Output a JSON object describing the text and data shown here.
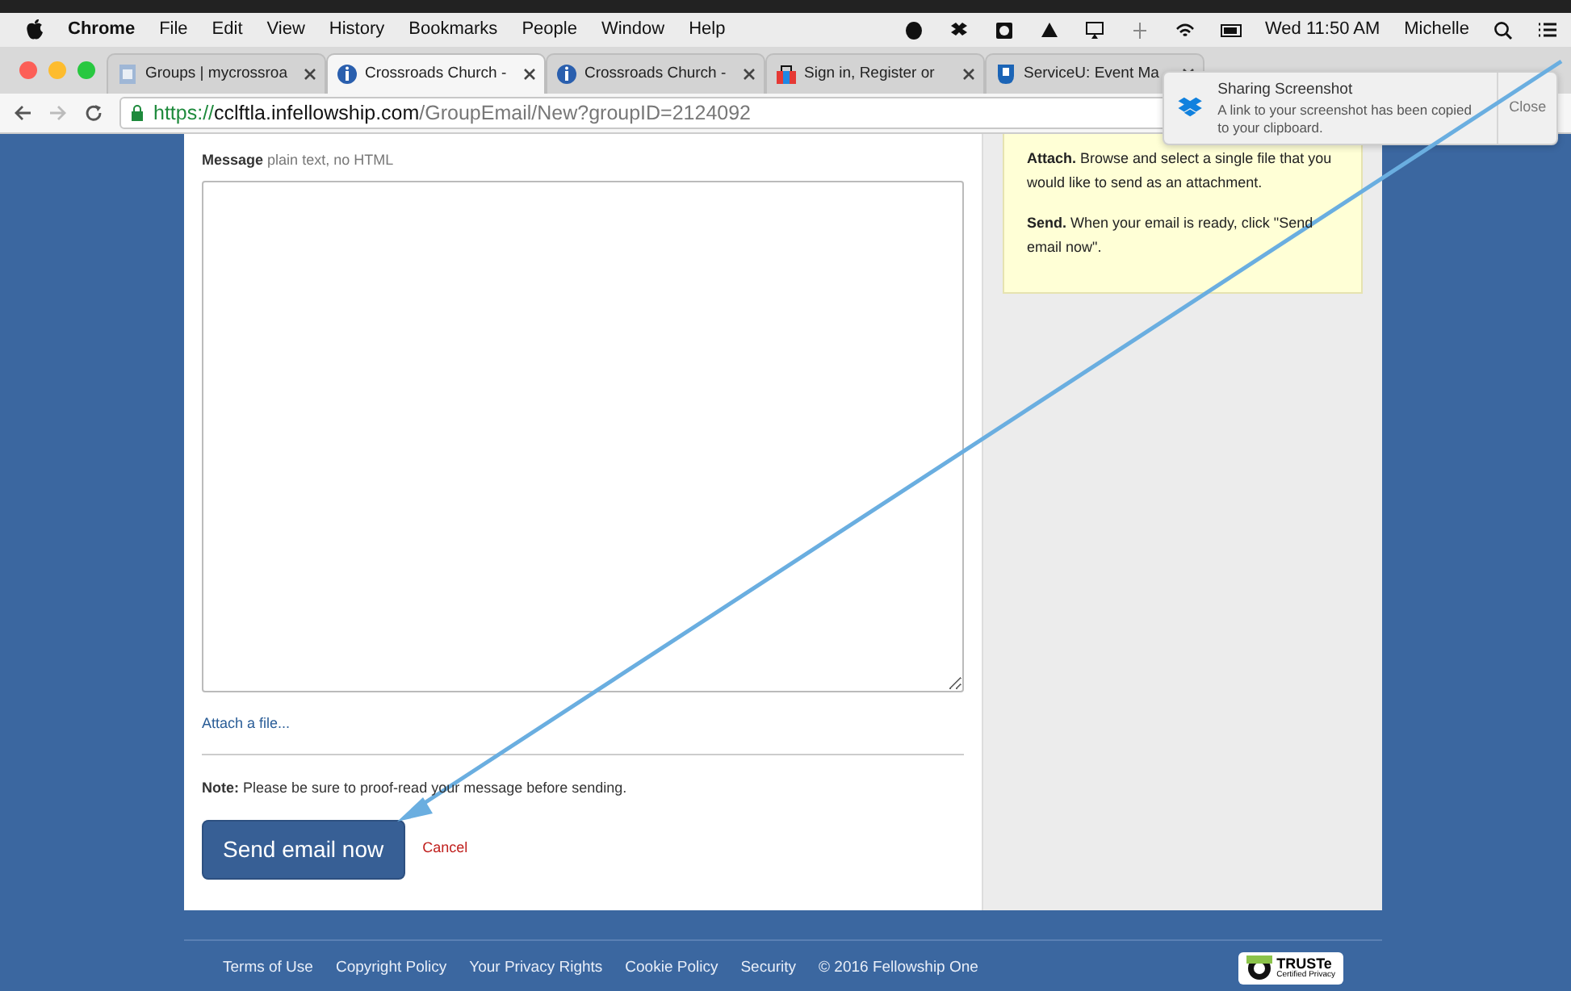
{
  "menu_bar": {
    "app": "Chrome",
    "items": [
      "File",
      "Edit",
      "View",
      "History",
      "Bookmarks",
      "People",
      "Window",
      "Help"
    ],
    "clock": "Wed 11:50 AM",
    "user": "Michelle"
  },
  "tabs": [
    {
      "title": "Groups | mycrossroa",
      "kind": "doc",
      "selected": false
    },
    {
      "title": "Crossroads Church -",
      "kind": "info",
      "selected": true
    },
    {
      "title": "Crossroads Church -",
      "kind": "info",
      "selected": false
    },
    {
      "title": "Sign in, Register or",
      "kind": "bag",
      "selected": false
    },
    {
      "title": "ServiceU: Event Ma",
      "kind": "u",
      "selected": false
    }
  ],
  "address_bar": {
    "scheme": "https://",
    "host": "cclftla.infellowship.com",
    "path": "/GroupEmail/New?groupID=2124092"
  },
  "form": {
    "message_label": "Message",
    "message_hint": "plain text, no HTML",
    "attach_link": "Attach a file...",
    "note": "**Note:** Please be sure to proof-read your message before sending.",
    "send_button": "Send email now",
    "cancel_link": "Cancel"
  },
  "help": [
    "**Attach.** Browse and select a single file that you would like to send as an attachment.",
    "**Send.** When your email is ready, click \"Send email now\"."
  ],
  "footer": {
    "links": [
      "Terms of Use",
      "Copyright Policy",
      "Your Privacy Rights",
      "Cookie Policy",
      "Security"
    ],
    "copyright": "© 2016 Fellowship One",
    "seal_title": "TRUSTe",
    "seal_subtitle": "Certified Privacy"
  },
  "notification": {
    "title": "Sharing Screenshot",
    "body": "A link to your screenshot has been copied to your clipboard.",
    "close": "Close"
  }
}
